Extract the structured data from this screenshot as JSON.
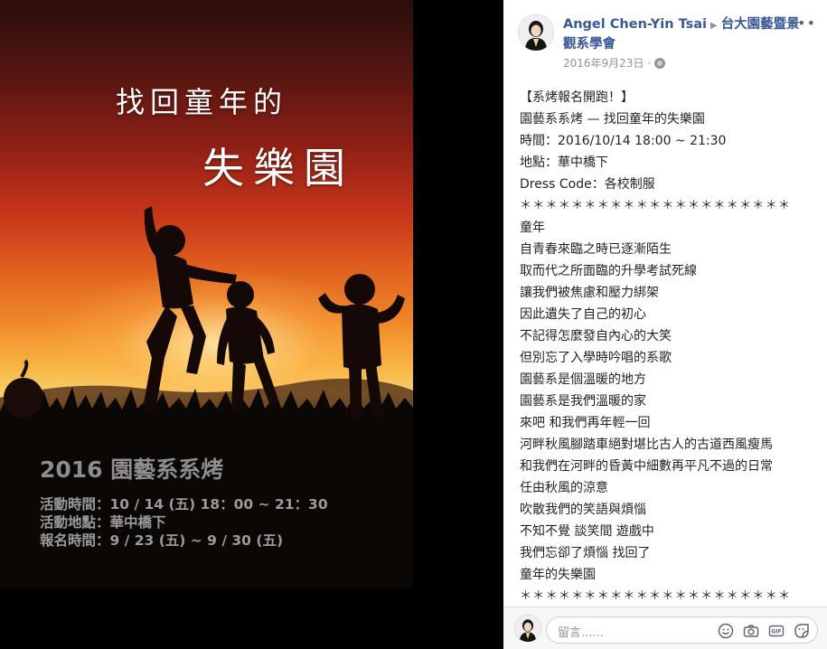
{
  "poster": {
    "title_line1": "找回童年的",
    "title_line2": "失樂園",
    "event_title": "2016 園藝系系烤",
    "details": [
      "活動時間：10 / 14 (五) 18：00 ~ 21：30",
      "活動地點：華中橋下",
      "報名時間：9 / 23 (五) ~ 9 / 30 (五)"
    ]
  },
  "post": {
    "author": "Angel Chen-Yin Tsai",
    "group": "台大園藝暨景觀系學會",
    "date": "2016年9月23日",
    "more_label": "•••",
    "body_lines": [
      "【系烤報名開跑！】",
      "園藝系系烤 — 找回童年的失樂園",
      "時間：2016/10/14 18:00 ~ 21:30",
      "地點：華中橋下",
      "Dress Code：各校制服",
      "＊＊＊＊＊＊＊＊＊＊＊＊＊＊＊＊＊＊＊＊＊",
      "童年",
      "自青春來臨之時已逐漸陌生",
      "取而代之所面臨的升學考試死線",
      "讓我們被焦慮和壓力綁架",
      "因此遺失了自己的初心",
      "不記得怎麼發自內心的大笑",
      "但別忘了入學時吟唱的系歌",
      "園藝系是個溫暖的地方",
      "園藝系是我們溫暖的家",
      "來吧 和我們再年輕一回",
      "河畔秋風腳踏車絕對堪比古人的古道西風瘦馬",
      "和我們在河畔的昏黃中細數再平凡不過的日常",
      "任由秋風的涼意",
      "吹散我們的笑語與煩惱",
      "不知不覺 談笑間 遊戲中",
      "我們忘卻了煩惱 找回了",
      "童年的失樂園",
      "＊＊＊＊＊＊＊＊＊＊＊＊＊＊＊＊＊＊＊＊＊"
    ]
  },
  "comment": {
    "placeholder": "留言......"
  },
  "icons": {
    "emoji": "emoji-icon",
    "camera": "camera-icon",
    "gif": "gif-icon",
    "sticker": "sticker-icon",
    "gif_label": "GIF"
  },
  "colors": {
    "link": "#385898",
    "meta": "#90949c",
    "text": "#1d2129"
  }
}
